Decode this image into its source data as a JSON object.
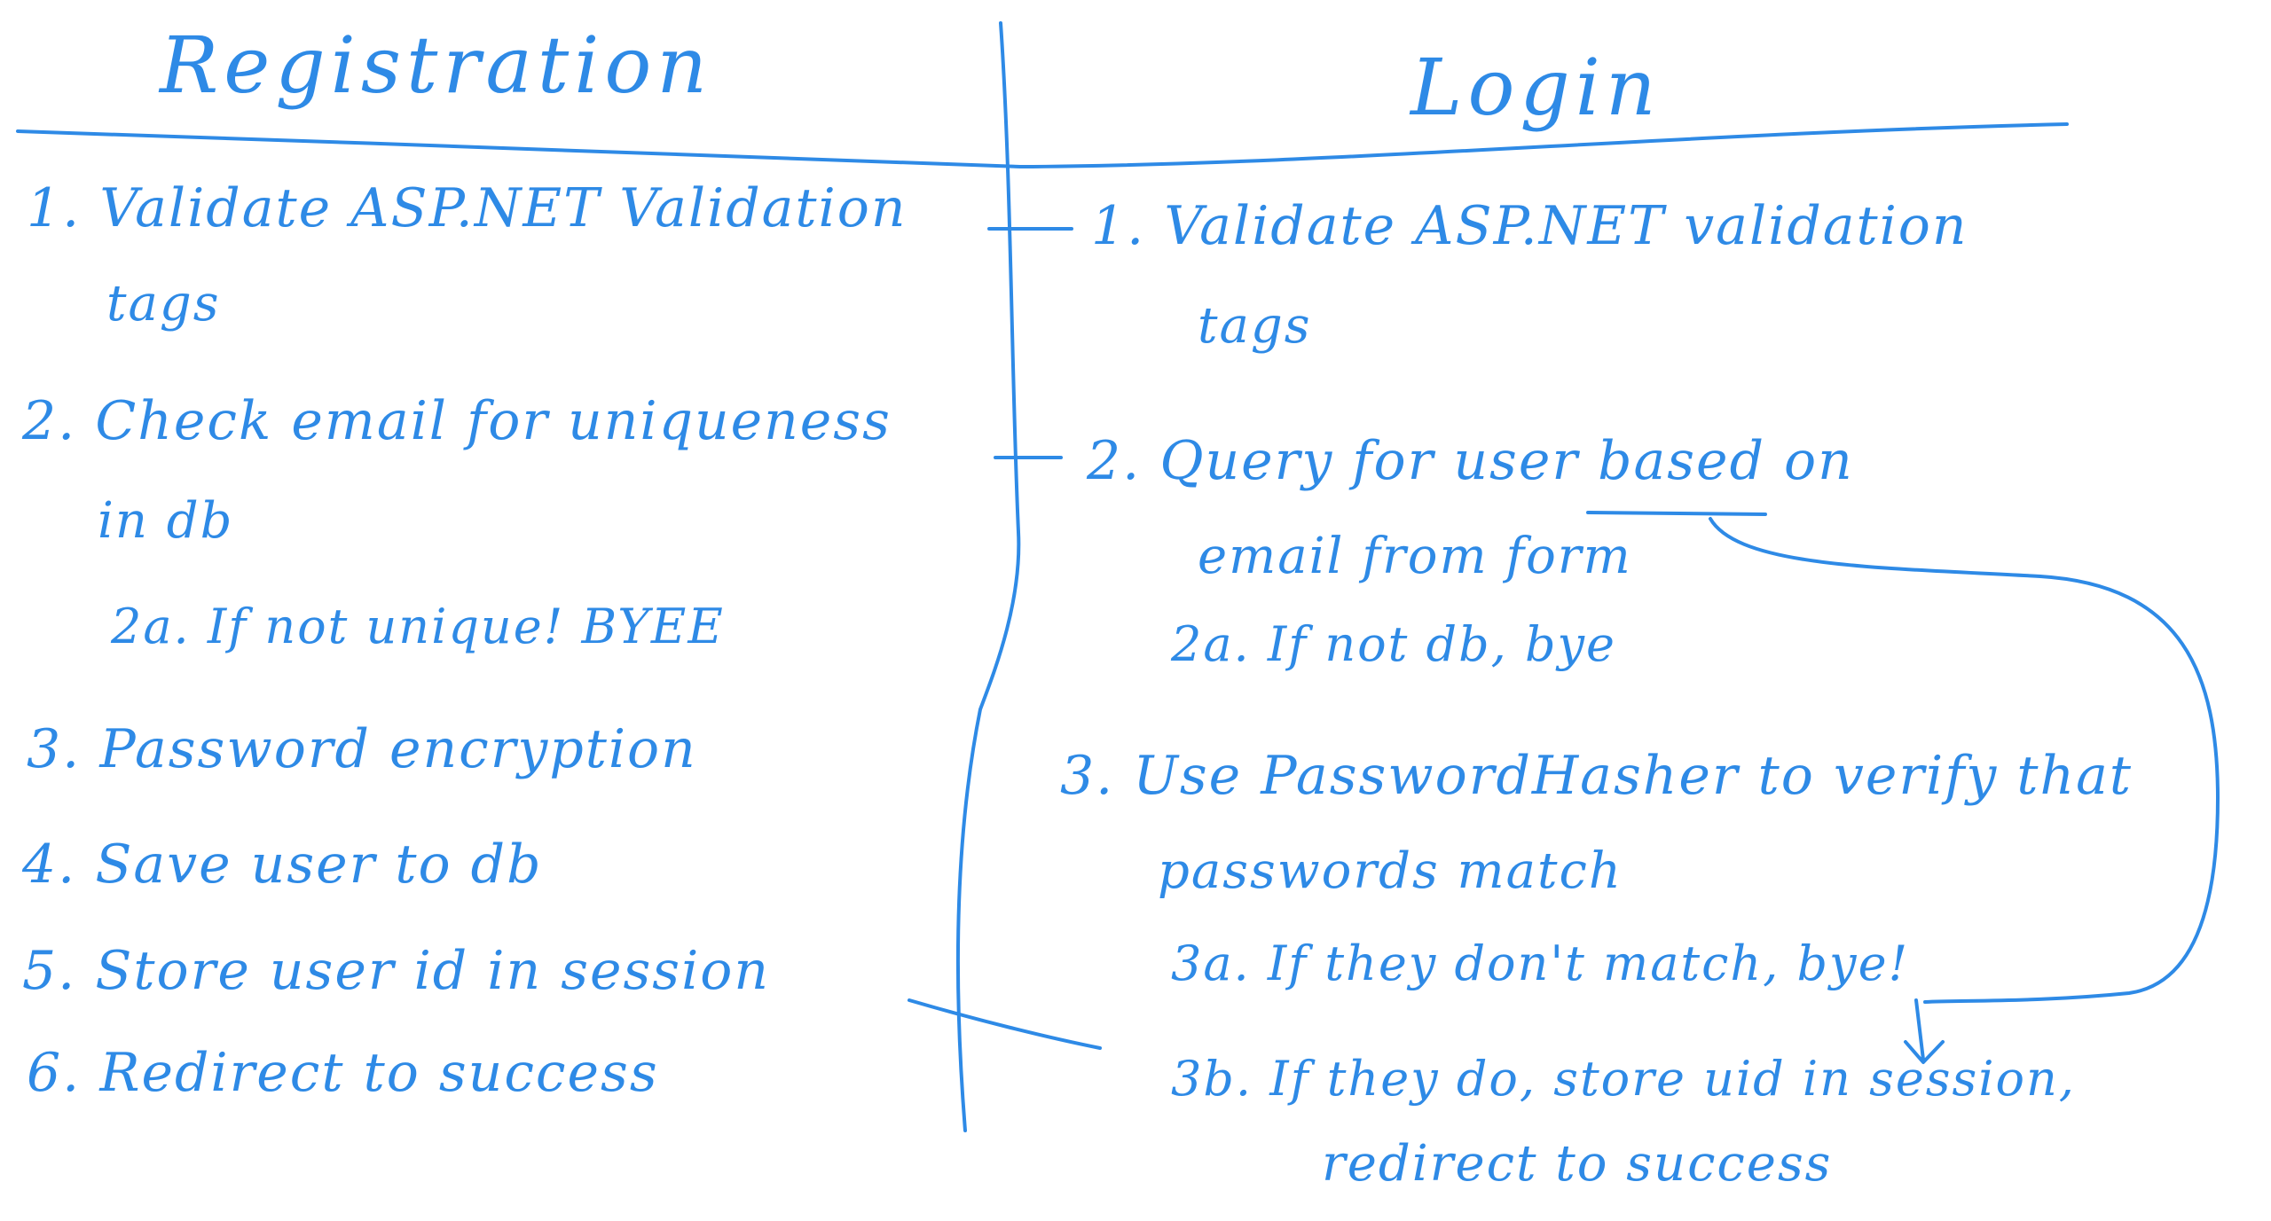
{
  "colors": {
    "ink": "#2e8ae6",
    "background": "#ffffff"
  },
  "registration": {
    "title": "Registration",
    "steps": [
      "1. Validate ASP.NET Validation",
      "tags",
      "2. Check email for uniqueness",
      "in db",
      "2a. If not unique! BYEE",
      "3. Password encryption",
      "4. Save user to db",
      "5. Store user id in session",
      "6. Redirect to success"
    ]
  },
  "login": {
    "title": "Login",
    "steps": [
      "1. Validate ASP.NET validation",
      "tags",
      "2. Query for user based on",
      "email from form",
      "2a. If not db, bye",
      "3. Use PasswordHasher to verify that",
      "passwords match",
      "3a. If they don't match, bye!",
      "3b. If they do, store uid in session,",
      "redirect to success"
    ]
  }
}
